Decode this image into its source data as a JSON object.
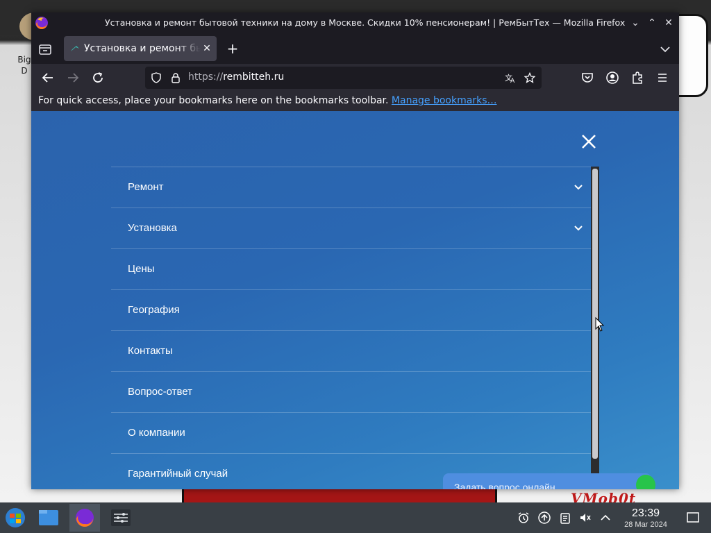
{
  "desktop": {
    "icon_label": "Big D",
    "wallpaper_text": "VMob0t"
  },
  "window": {
    "title": "Установка и ремонт бытовой техники на дому в Москве. Скидки 10% пенсионерам! | РемБытТех — Mozilla Firefox",
    "buttons": {
      "minimize": "⌄",
      "maximize": "⌃",
      "close": "✕"
    }
  },
  "tabs": [
    {
      "title": "Установка и ремонт бытовой техники",
      "close": "✕"
    }
  ],
  "new_tab_label": "+",
  "urlbar": {
    "protocol": "https://",
    "host": "rembitteh.ru"
  },
  "bookmarks_bar": {
    "message": "For quick access, place your bookmarks here on the bookmarks toolbar.",
    "link": "Manage bookmarks…"
  },
  "menu": {
    "items": [
      {
        "label": "Ремонт",
        "expandable": true
      },
      {
        "label": "Установка",
        "expandable": true
      },
      {
        "label": "Цены",
        "expandable": false
      },
      {
        "label": "География",
        "expandable": false
      },
      {
        "label": "Контакты",
        "expandable": false
      },
      {
        "label": "Вопрос-ответ",
        "expandable": false
      },
      {
        "label": "О компании",
        "expandable": false
      },
      {
        "label": "Гарантийный случай",
        "expandable": false
      }
    ]
  },
  "chat": {
    "label": "Задать вопрос онлайн"
  },
  "taskbar": {
    "time": "23:39",
    "date": "28 Mar 2024"
  },
  "colors": {
    "page_blue": "#2a67b2",
    "chat_blue": "#4f8ee0",
    "chat_green": "#27c44a",
    "link": "#45a1ff"
  }
}
